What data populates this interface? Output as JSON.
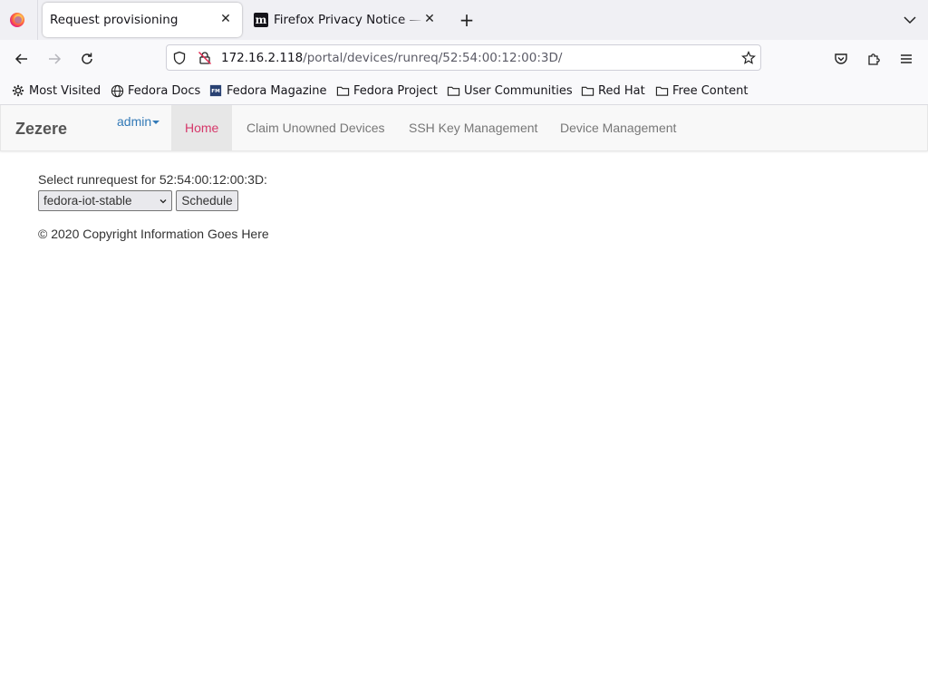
{
  "browser": {
    "tabs": [
      {
        "title": "Request provisioning",
        "active": true
      },
      {
        "title": "Firefox Privacy Notice — Mozilla",
        "favicon": "m",
        "active": false
      }
    ],
    "url": {
      "host": "172.16.2.118",
      "path": "/portal/devices/runreq/52:54:00:12:00:3D/"
    },
    "bookmarks": [
      {
        "label": "Most Visited",
        "icon": "gear-icon"
      },
      {
        "label": "Fedora Docs",
        "icon": "globe-icon"
      },
      {
        "label": "Fedora Magazine",
        "icon": "fm-icon"
      },
      {
        "label": "Fedora Project",
        "icon": "folder-icon"
      },
      {
        "label": "User Communities",
        "icon": "folder-icon"
      },
      {
        "label": "Red Hat",
        "icon": "folder-icon"
      },
      {
        "label": "Free Content",
        "icon": "folder-icon"
      }
    ]
  },
  "site": {
    "brand": "Zezere",
    "user": "admin",
    "nav": [
      {
        "label": "Home",
        "active": true
      },
      {
        "label": "Claim Unowned Devices"
      },
      {
        "label": "SSH Key Management"
      },
      {
        "label": "Device Management"
      }
    ],
    "accent_color": "#d6386a",
    "link_color": "#337ab7"
  },
  "form": {
    "label": "Select runrequest for 52:54:00:12:00:3D:",
    "selected_option": "fedora-iot-stable",
    "submit_label": "Schedule"
  },
  "footer": "© 2020 Copyright Information Goes Here"
}
